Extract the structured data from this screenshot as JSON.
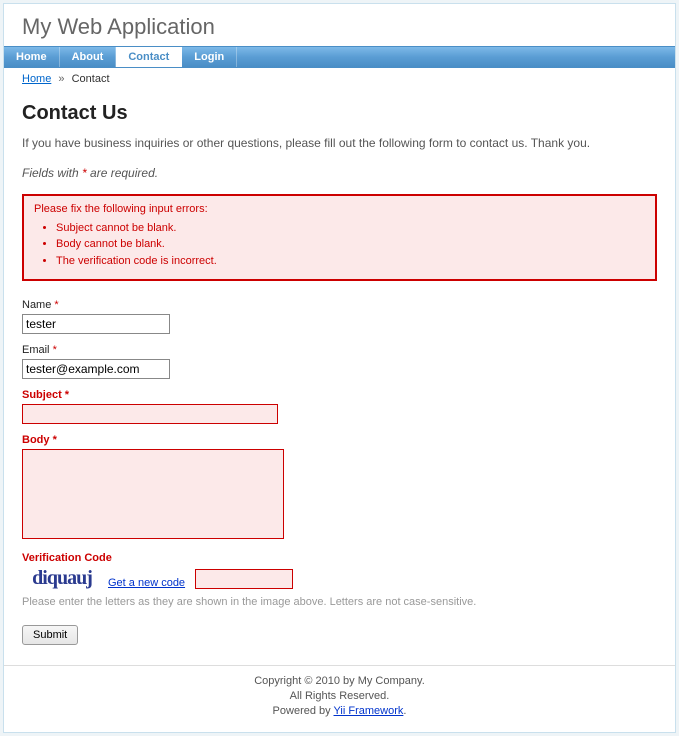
{
  "header": {
    "title": "My Web Application"
  },
  "nav": {
    "home": "Home",
    "about": "About",
    "contact": "Contact",
    "login": "Login"
  },
  "breadcrumb": {
    "home": "Home",
    "sep": "»",
    "current": "Contact"
  },
  "page": {
    "heading": "Contact Us",
    "intro": "If you have business inquiries or other questions, please fill out the following form to contact us. Thank you.",
    "required_note_pre": "Fields with ",
    "required_star": "*",
    "required_note_post": " are required."
  },
  "errors": {
    "title": "Please fix the following input errors:",
    "items": [
      "Subject cannot be blank.",
      "Body cannot be blank.",
      "The verification code is incorrect."
    ]
  },
  "form": {
    "name_label": "Name",
    "name_value": "tester",
    "email_label": "Email",
    "email_value": "tester@example.com",
    "subject_label": "Subject",
    "subject_value": "",
    "body_label": "Body",
    "body_value": "",
    "captcha_label": "Verification Code",
    "captcha_text": "diquauj",
    "captcha_refresh": "Get a new code",
    "captcha_value": "",
    "hint": "Please enter the letters as they are shown in the image above. Letters are not case-sensitive.",
    "submit": "Submit"
  },
  "footer": {
    "copyright": "Copyright © 2010 by My Company.",
    "rights": "All Rights Reserved.",
    "powered_pre": "Powered by ",
    "powered_link": "Yii Framework",
    "powered_post": "."
  }
}
